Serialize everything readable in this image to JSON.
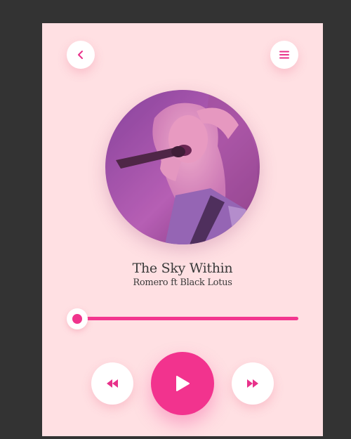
{
  "app": {
    "accent_color": "#f2338e",
    "background_color": "#ffe0e3"
  },
  "header": {
    "back_icon": "chevron-left-icon",
    "menu_icon": "hamburger-menu-icon"
  },
  "track": {
    "title": "The Sky Within",
    "artist": "Romero ft Black Lotus",
    "cover_art": "album-cover-singer-image"
  },
  "playback": {
    "progress": 0.0,
    "state": "paused"
  },
  "controls": {
    "rewind_icon": "rewind-icon",
    "play_icon": "play-icon",
    "forward_icon": "fast-forward-icon"
  }
}
